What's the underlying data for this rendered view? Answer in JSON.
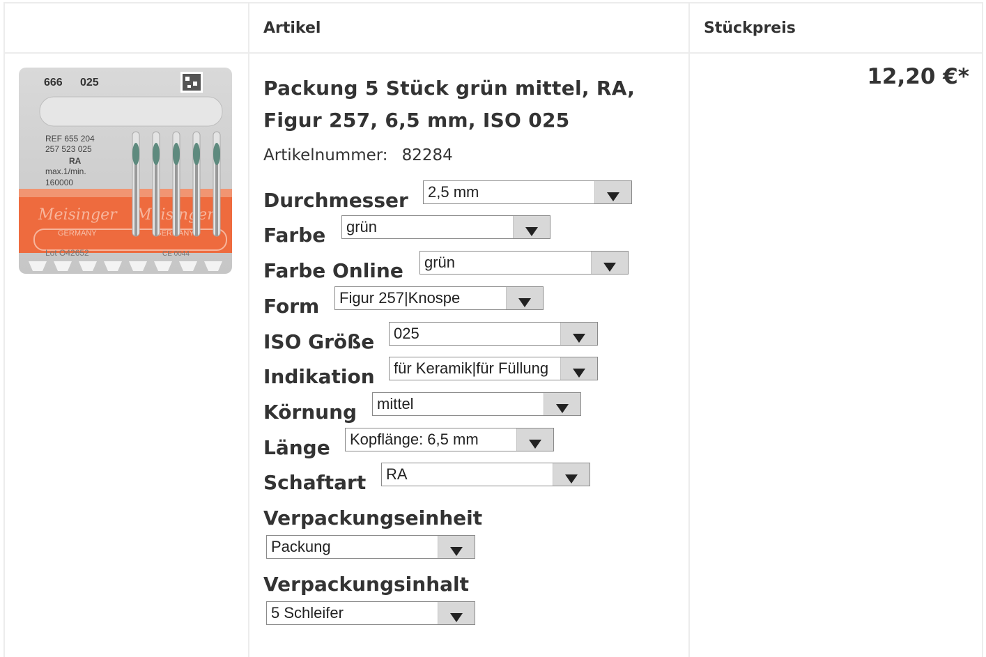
{
  "table": {
    "header_article": "Artikel",
    "header_price": "Stückpreis"
  },
  "product": {
    "title": "Packung 5 Stück grün mittel, RA, Figur 257, 6,5 mm, ISO 025",
    "artnr_label": "Artikelnummer:",
    "artnr_value": "82284",
    "price": "12,20 €*",
    "image": {
      "line1_left": "666",
      "line1_right": "025",
      "ref": "REF 655 204",
      "code": "257 523 025",
      "type": "RA",
      "speed_label": "max.1/min.",
      "speed": "160000",
      "brand": "Meisinger",
      "country": "GERMANY",
      "lot": "Lot  O42652",
      "ce": "CE 0044"
    }
  },
  "options": [
    {
      "label": "Durchmesser",
      "value": "2,5 mm"
    },
    {
      "label": "Farbe",
      "value": "grün"
    },
    {
      "label": "Farbe Online",
      "value": "grün"
    },
    {
      "label": "Form",
      "value": "Figur 257|Knospe"
    },
    {
      "label": "ISO Größe",
      "value": "025"
    },
    {
      "label": "Indikation",
      "value": "für Keramik|für Füllung"
    },
    {
      "label": "Körnung",
      "value": "mittel"
    },
    {
      "label": "Länge",
      "value": "Kopflänge: 6,5 mm"
    },
    {
      "label": "Schaftart",
      "value": "RA"
    },
    {
      "label": "Verpackungseinheit",
      "value": "Packung"
    },
    {
      "label": "Verpackungsinhalt",
      "value": "5 Schleifer"
    }
  ],
  "colors": {
    "accent_orange": "#ee6b3e",
    "bur_green": "#5e8a7e"
  }
}
